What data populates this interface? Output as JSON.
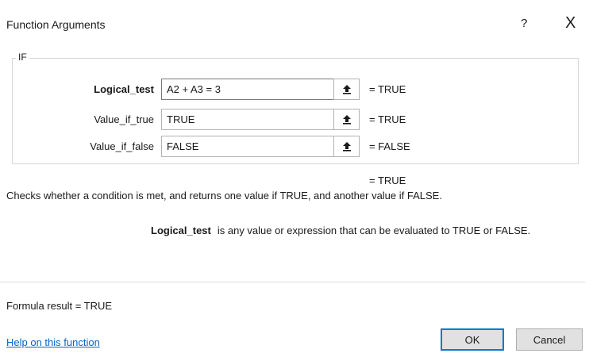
{
  "dialog": {
    "title": "Function Arguments",
    "help_button": "?",
    "close_button": "X"
  },
  "function": {
    "name": "IF",
    "arguments": [
      {
        "label": "Logical_test",
        "value": "A2 + A3 = 3",
        "result": "=  TRUE",
        "bold": true
      },
      {
        "label": "Value_if_true",
        "value": "TRUE",
        "result": "=  TRUE",
        "bold": false
      },
      {
        "label": "Value_if_false",
        "value": "FALSE",
        "result": "=  FALSE",
        "bold": false
      }
    ],
    "overall_result": "=  TRUE",
    "description": "Checks whether a condition is met, and returns one value if TRUE, and another value if FALSE.",
    "arg_help_name": "Logical_test",
    "arg_help_text": "is any value or expression that can be evaluated to TRUE or FALSE."
  },
  "footer": {
    "formula_result": "Formula result =   TRUE",
    "help_link": "Help on this function",
    "ok_label": "OK",
    "cancel_label": "Cancel"
  },
  "icons": {
    "collapse": "collapse-dialog-icon",
    "accent_color": "#0078d7"
  }
}
